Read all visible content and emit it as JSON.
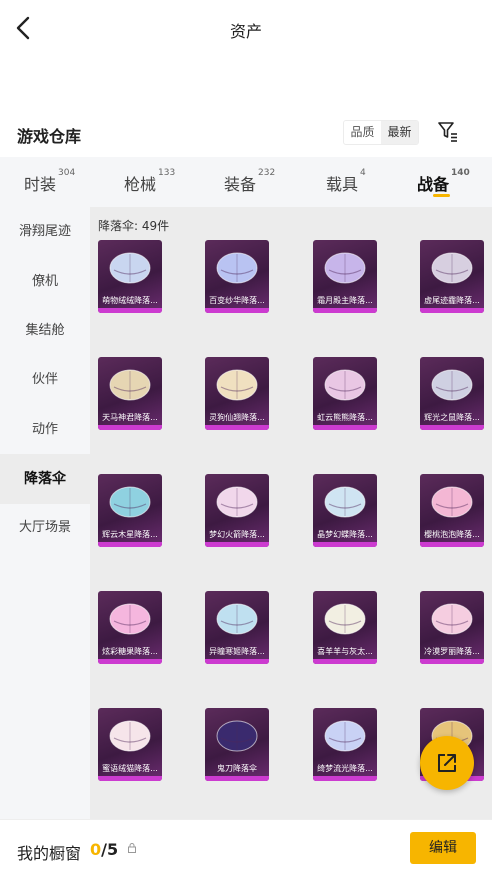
{
  "header": {
    "title": "资产",
    "back_icon": "chevron-left-icon"
  },
  "section": {
    "title": "游戏仓库",
    "sort_options": [
      "品质",
      "最新"
    ],
    "sort_selected": "最新",
    "filter_icon": "filter-icon"
  },
  "tabs": [
    {
      "label": "时装",
      "count": "304"
    },
    {
      "label": "枪械",
      "count": "133"
    },
    {
      "label": "装备",
      "count": "232"
    },
    {
      "label": "载具",
      "count": "4"
    },
    {
      "label": "战备",
      "count": "140"
    }
  ],
  "active_tab": "战备",
  "sidebar": [
    {
      "label": "滑翔尾迹"
    },
    {
      "label": "僚机"
    },
    {
      "label": "集结舱"
    },
    {
      "label": "伙伴"
    },
    {
      "label": "动作"
    },
    {
      "label": "降落伞"
    },
    {
      "label": "大厅场景"
    }
  ],
  "active_sidebar": "降落伞",
  "grid": {
    "count_label": "降落伞: 49件",
    "items": [
      {
        "label": "萌物绒绒降落...",
        "color": "#c9d6f0"
      },
      {
        "label": "百变纱华降落...",
        "color": "#b9c3f2"
      },
      {
        "label": "霜月殿主降落...",
        "color": "#c7b5ea"
      },
      {
        "label": "虚尾迹霾降落...",
        "color": "#d7cfe0"
      },
      {
        "label": "天马神君降落...",
        "color": "#e6d6b3"
      },
      {
        "label": "灵狗仙翘降落...",
        "color": "#f0e0c0"
      },
      {
        "label": "虹云熊熊降落...",
        "color": "#e9c7e4"
      },
      {
        "label": "辉光之鼠降落...",
        "color": "#cfd0e2"
      },
      {
        "label": "辉云木星降落...",
        "color": "#8fd1e0"
      },
      {
        "label": "梦幻火箭降落...",
        "color": "#f1d7eb"
      },
      {
        "label": "晶梦幻蝶降落...",
        "color": "#cfe4f2"
      },
      {
        "label": "樱桃泡泡降落...",
        "color": "#f4b7d4"
      },
      {
        "label": "炫彩糖果降落...",
        "color": "#f5b6de"
      },
      {
        "label": "异瞳寒姬降落...",
        "color": "#bfe0f0"
      },
      {
        "label": "喜羊羊与灰太...",
        "color": "#f2efe2"
      },
      {
        "label": "冷漠罗丽降落...",
        "color": "#f5cde0"
      },
      {
        "label": "蜜语绒猫降落...",
        "color": "#f6e5ea"
      },
      {
        "label": "鬼刀降落伞",
        "color": "#3a2a6e"
      },
      {
        "label": "绮梦流光降落...",
        "color": "#c9d2f5"
      },
      {
        "label": "",
        "color": "#e6c47a"
      }
    ]
  },
  "fab": {
    "icon": "external-link-icon"
  },
  "bottom": {
    "window_label": "我的橱窗",
    "window_current": "0",
    "window_total": "/5",
    "lock_icon": "lock-icon",
    "edit_label": "编辑"
  },
  "colors": {
    "accent": "#f7b500",
    "card_bg": "#4a2150",
    "card_border": "#cc3bd0"
  }
}
